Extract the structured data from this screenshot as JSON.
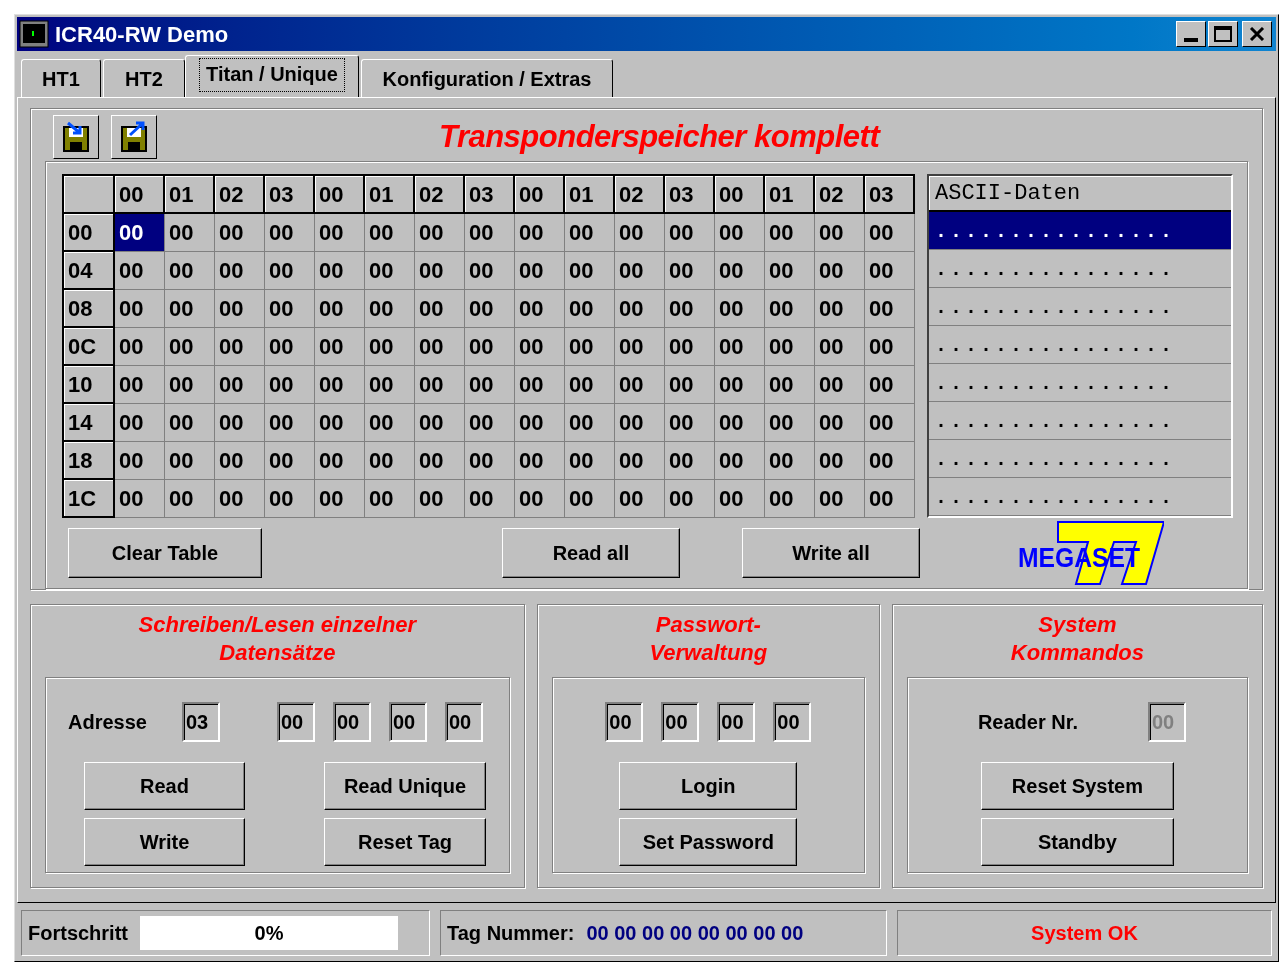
{
  "window": {
    "title": "ICR40-RW Demo"
  },
  "tabs": [
    {
      "label": "HT1",
      "selected": false
    },
    {
      "label": "HT2",
      "selected": false
    },
    {
      "label": "Titan / Unique",
      "selected": true
    },
    {
      "label": "Konfiguration / Extras",
      "selected": false
    }
  ],
  "memory": {
    "title": "Transponderspeicher komplett",
    "columns": [
      "00",
      "01",
      "02",
      "03",
      "00",
      "01",
      "02",
      "03",
      "00",
      "01",
      "02",
      "03",
      "00",
      "01",
      "02",
      "03"
    ],
    "ascii_header": "ASCII-Daten",
    "rows": [
      {
        "address": "00",
        "ascii": "................",
        "selected": true,
        "cells": [
          {
            "value": "00",
            "selected": true
          },
          {
            "value": "00",
            "selected": false
          },
          {
            "value": "00",
            "selected": false
          },
          {
            "value": "00",
            "selected": false
          },
          {
            "value": "00",
            "selected": false
          },
          {
            "value": "00",
            "selected": false
          },
          {
            "value": "00",
            "selected": false
          },
          {
            "value": "00",
            "selected": false
          },
          {
            "value": "00",
            "selected": false
          },
          {
            "value": "00",
            "selected": false
          },
          {
            "value": "00",
            "selected": false
          },
          {
            "value": "00",
            "selected": false
          },
          {
            "value": "00",
            "selected": false
          },
          {
            "value": "00",
            "selected": false
          },
          {
            "value": "00",
            "selected": false
          },
          {
            "value": "00",
            "selected": false
          }
        ]
      },
      {
        "address": "04",
        "ascii": "................",
        "selected": false,
        "cells": [
          {
            "value": "00",
            "selected": false
          },
          {
            "value": "00",
            "selected": false
          },
          {
            "value": "00",
            "selected": false
          },
          {
            "value": "00",
            "selected": false
          },
          {
            "value": "00",
            "selected": false
          },
          {
            "value": "00",
            "selected": false
          },
          {
            "value": "00",
            "selected": false
          },
          {
            "value": "00",
            "selected": false
          },
          {
            "value": "00",
            "selected": false
          },
          {
            "value": "00",
            "selected": false
          },
          {
            "value": "00",
            "selected": false
          },
          {
            "value": "00",
            "selected": false
          },
          {
            "value": "00",
            "selected": false
          },
          {
            "value": "00",
            "selected": false
          },
          {
            "value": "00",
            "selected": false
          },
          {
            "value": "00",
            "selected": false
          }
        ]
      },
      {
        "address": "08",
        "ascii": "................",
        "selected": false,
        "cells": [
          {
            "value": "00",
            "selected": false
          },
          {
            "value": "00",
            "selected": false
          },
          {
            "value": "00",
            "selected": false
          },
          {
            "value": "00",
            "selected": false
          },
          {
            "value": "00",
            "selected": false
          },
          {
            "value": "00",
            "selected": false
          },
          {
            "value": "00",
            "selected": false
          },
          {
            "value": "00",
            "selected": false
          },
          {
            "value": "00",
            "selected": false
          },
          {
            "value": "00",
            "selected": false
          },
          {
            "value": "00",
            "selected": false
          },
          {
            "value": "00",
            "selected": false
          },
          {
            "value": "00",
            "selected": false
          },
          {
            "value": "00",
            "selected": false
          },
          {
            "value": "00",
            "selected": false
          },
          {
            "value": "00",
            "selected": false
          }
        ]
      },
      {
        "address": "0C",
        "ascii": "................",
        "selected": false,
        "cells": [
          {
            "value": "00",
            "selected": false
          },
          {
            "value": "00",
            "selected": false
          },
          {
            "value": "00",
            "selected": false
          },
          {
            "value": "00",
            "selected": false
          },
          {
            "value": "00",
            "selected": false
          },
          {
            "value": "00",
            "selected": false
          },
          {
            "value": "00",
            "selected": false
          },
          {
            "value": "00",
            "selected": false
          },
          {
            "value": "00",
            "selected": false
          },
          {
            "value": "00",
            "selected": false
          },
          {
            "value": "00",
            "selected": false
          },
          {
            "value": "00",
            "selected": false
          },
          {
            "value": "00",
            "selected": false
          },
          {
            "value": "00",
            "selected": false
          },
          {
            "value": "00",
            "selected": false
          },
          {
            "value": "00",
            "selected": false
          }
        ]
      },
      {
        "address": "10",
        "ascii": "................",
        "selected": false,
        "cells": [
          {
            "value": "00",
            "selected": false
          },
          {
            "value": "00",
            "selected": false
          },
          {
            "value": "00",
            "selected": false
          },
          {
            "value": "00",
            "selected": false
          },
          {
            "value": "00",
            "selected": false
          },
          {
            "value": "00",
            "selected": false
          },
          {
            "value": "00",
            "selected": false
          },
          {
            "value": "00",
            "selected": false
          },
          {
            "value": "00",
            "selected": false
          },
          {
            "value": "00",
            "selected": false
          },
          {
            "value": "00",
            "selected": false
          },
          {
            "value": "00",
            "selected": false
          },
          {
            "value": "00",
            "selected": false
          },
          {
            "value": "00",
            "selected": false
          },
          {
            "value": "00",
            "selected": false
          },
          {
            "value": "00",
            "selected": false
          }
        ]
      },
      {
        "address": "14",
        "ascii": "................",
        "selected": false,
        "cells": [
          {
            "value": "00",
            "selected": false
          },
          {
            "value": "00",
            "selected": false
          },
          {
            "value": "00",
            "selected": false
          },
          {
            "value": "00",
            "selected": false
          },
          {
            "value": "00",
            "selected": false
          },
          {
            "value": "00",
            "selected": false
          },
          {
            "value": "00",
            "selected": false
          },
          {
            "value": "00",
            "selected": false
          },
          {
            "value": "00",
            "selected": false
          },
          {
            "value": "00",
            "selected": false
          },
          {
            "value": "00",
            "selected": false
          },
          {
            "value": "00",
            "selected": false
          },
          {
            "value": "00",
            "selected": false
          },
          {
            "value": "00",
            "selected": false
          },
          {
            "value": "00",
            "selected": false
          },
          {
            "value": "00",
            "selected": false
          }
        ]
      },
      {
        "address": "18",
        "ascii": "................",
        "selected": false,
        "cells": [
          {
            "value": "00",
            "selected": false
          },
          {
            "value": "00",
            "selected": false
          },
          {
            "value": "00",
            "selected": false
          },
          {
            "value": "00",
            "selected": false
          },
          {
            "value": "00",
            "selected": false
          },
          {
            "value": "00",
            "selected": false
          },
          {
            "value": "00",
            "selected": false
          },
          {
            "value": "00",
            "selected": false
          },
          {
            "value": "00",
            "selected": false
          },
          {
            "value": "00",
            "selected": false
          },
          {
            "value": "00",
            "selected": false
          },
          {
            "value": "00",
            "selected": false
          },
          {
            "value": "00",
            "selected": false
          },
          {
            "value": "00",
            "selected": false
          },
          {
            "value": "00",
            "selected": false
          },
          {
            "value": "00",
            "selected": false
          }
        ]
      },
      {
        "address": "1C",
        "ascii": "................",
        "selected": false,
        "cells": [
          {
            "value": "00",
            "selected": false
          },
          {
            "value": "00",
            "selected": false
          },
          {
            "value": "00",
            "selected": false
          },
          {
            "value": "00",
            "selected": false
          },
          {
            "value": "00",
            "selected": false
          },
          {
            "value": "00",
            "selected": false
          },
          {
            "value": "00",
            "selected": false
          },
          {
            "value": "00",
            "selected": false
          },
          {
            "value": "00",
            "selected": false
          },
          {
            "value": "00",
            "selected": false
          },
          {
            "value": "00",
            "selected": false
          },
          {
            "value": "00",
            "selected": false
          },
          {
            "value": "00",
            "selected": false
          },
          {
            "value": "00",
            "selected": false
          },
          {
            "value": "00",
            "selected": false
          },
          {
            "value": "00",
            "selected": false
          }
        ]
      }
    ],
    "buttons": [
      "Clear Table",
      "Read all",
      "Write all"
    ],
    "logo": "MEGASET"
  },
  "single_records": {
    "title_lines": [
      "Schreiben/Lesen einzelner",
      "Datensätze"
    ],
    "address_label": "Adresse",
    "address": "03",
    "data_fields": [
      "00",
      "00",
      "00",
      "00"
    ],
    "buttons": [
      "Read",
      "Read Unique",
      "Write",
      "Reset Tag"
    ]
  },
  "password": {
    "title_lines": [
      "Passwort-",
      "Verwaltung"
    ],
    "fields": [
      "00",
      "00",
      "00",
      "00"
    ],
    "buttons": [
      "Login",
      "Set Password"
    ]
  },
  "system": {
    "title_lines": [
      "System",
      "Kommandos"
    ],
    "reader_label": "Reader Nr.",
    "reader_field": {
      "value": "00",
      "disabled": true
    },
    "buttons": [
      "Reset System",
      "Standby"
    ]
  },
  "status_bar": {
    "progress_label": "Fortschritt",
    "progress": {
      "level": 0,
      "reading": "0%"
    },
    "tag_label": "Tag Nummer:",
    "tag_number": "00 00 00 00 00 00 00 00",
    "status": "System OK"
  }
}
